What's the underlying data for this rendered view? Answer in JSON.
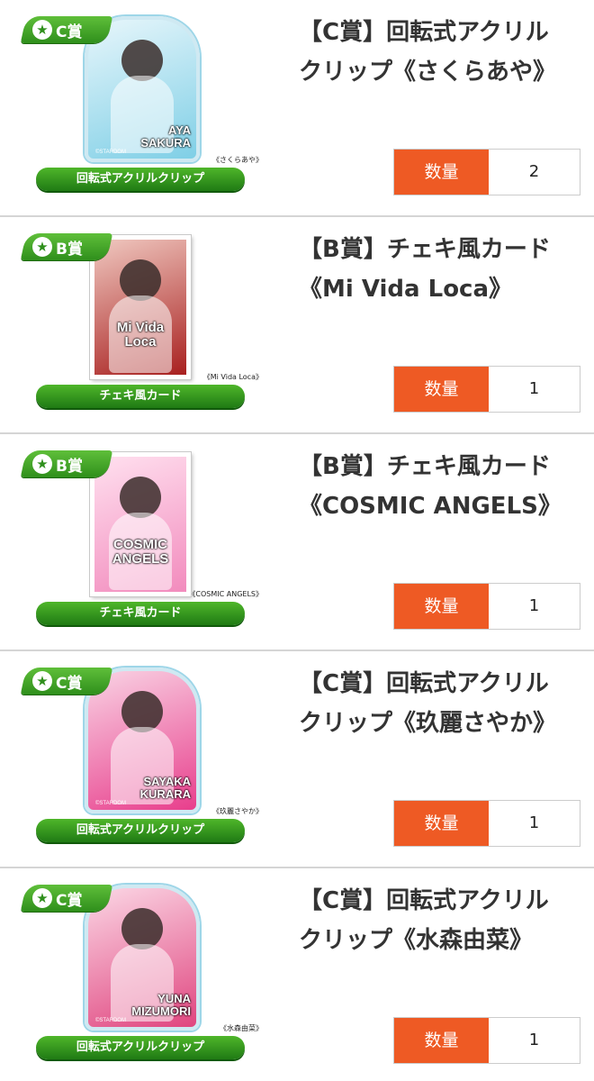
{
  "colors": {
    "accent_orange": "#ee5a24",
    "badge_green": "#2f8f1c",
    "title_text": "#333333",
    "divider": "#d5d5d5"
  },
  "items": [
    {
      "tier": "C賞",
      "tier_icon": "star-icon",
      "art_style": "acrylic",
      "art_colors": [
        "#7fcfe6",
        "#e7f6fb"
      ],
      "art_name": "AYA\nSAKURA",
      "art_maker": "©STARDOM",
      "caption": "《さくらあや》",
      "product_type": "回転式アクリルクリップ",
      "title": "【C賞】回転式アクリルクリップ《さくらあや》",
      "qty_label": "数量",
      "qty_value": "2"
    },
    {
      "tier": "B賞",
      "tier_icon": "star-icon",
      "art_style": "card",
      "art_colors": [
        "#a8201f",
        "#f0c8c0"
      ],
      "art_name": "Mi Vida Loca",
      "art_maker": "",
      "caption": "《Mi Vida Loca》",
      "product_type": "チェキ風カード",
      "title": "【B賞】チェキ風カード《Mi Vida Loca》",
      "qty_label": "数量",
      "qty_value": "1"
    },
    {
      "tier": "B賞",
      "tier_icon": "star-icon",
      "art_style": "card",
      "art_colors": [
        "#f28bbd",
        "#ffe0ef"
      ],
      "art_name": "COSMIC\nANGELS",
      "art_maker": "",
      "caption": "《COSMIC ANGELS》",
      "product_type": "チェキ風カード",
      "title": "【B賞】チェキ風カード《COSMIC ANGELS》",
      "qty_label": "数量",
      "qty_value": "1"
    },
    {
      "tier": "C賞",
      "tier_icon": "star-icon",
      "art_style": "acrylic",
      "art_colors": [
        "#e83e8c",
        "#f9d3e4"
      ],
      "art_name": "SAYAKA\nKURARA",
      "art_maker": "©STARDOM",
      "caption": "《玖麗さやか》",
      "product_type": "回転式アクリルクリップ",
      "title": "【C賞】回転式アクリルクリップ《玖麗さやか》",
      "qty_label": "数量",
      "qty_value": "1"
    },
    {
      "tier": "C賞",
      "tier_icon": "star-icon",
      "art_style": "acrylic",
      "art_colors": [
        "#e0457f",
        "#fbd7e5"
      ],
      "art_name": "YUNA\nMIZUMORI",
      "art_maker": "©STARDOM",
      "caption": "《水森由菜》",
      "product_type": "回転式アクリルクリップ",
      "title": "【C賞】回転式アクリルクリップ《水森由菜》",
      "qty_label": "数量",
      "qty_value": "1"
    }
  ]
}
